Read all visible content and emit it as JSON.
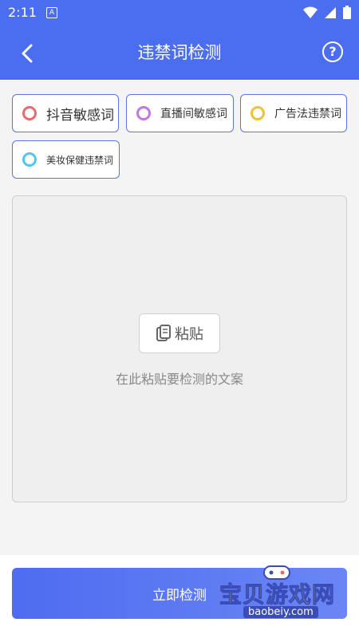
{
  "status_bar": {
    "time": "2:11",
    "notif_glyph": "A",
    "icons": [
      "wifi-icon",
      "signal-icon",
      "battery-icon"
    ]
  },
  "header": {
    "title": "违禁词检测",
    "back_icon": "chevron-left-icon",
    "help_icon": "question-circle-icon",
    "help_glyph": "?"
  },
  "categories": [
    {
      "label": "抖音敏感词",
      "color": "#e86a6a"
    },
    {
      "label": "直播间敏感词",
      "color": "#c774e8"
    },
    {
      "label": "广告法违禁词",
      "color": "#f2c233"
    },
    {
      "label": "美妆保健违禁词",
      "color": "#4fc8f0"
    }
  ],
  "input": {
    "paste_label": "粘贴",
    "hint": "在此粘贴要检测的文案"
  },
  "action": {
    "detect_label": "立即检测"
  },
  "watermark": {
    "text": "宝贝游戏网",
    "url": "baobeiy.com"
  },
  "colors": {
    "accent": "#4b6df0",
    "chip_border": "#5a74e8",
    "background": "#f4f4f4"
  }
}
